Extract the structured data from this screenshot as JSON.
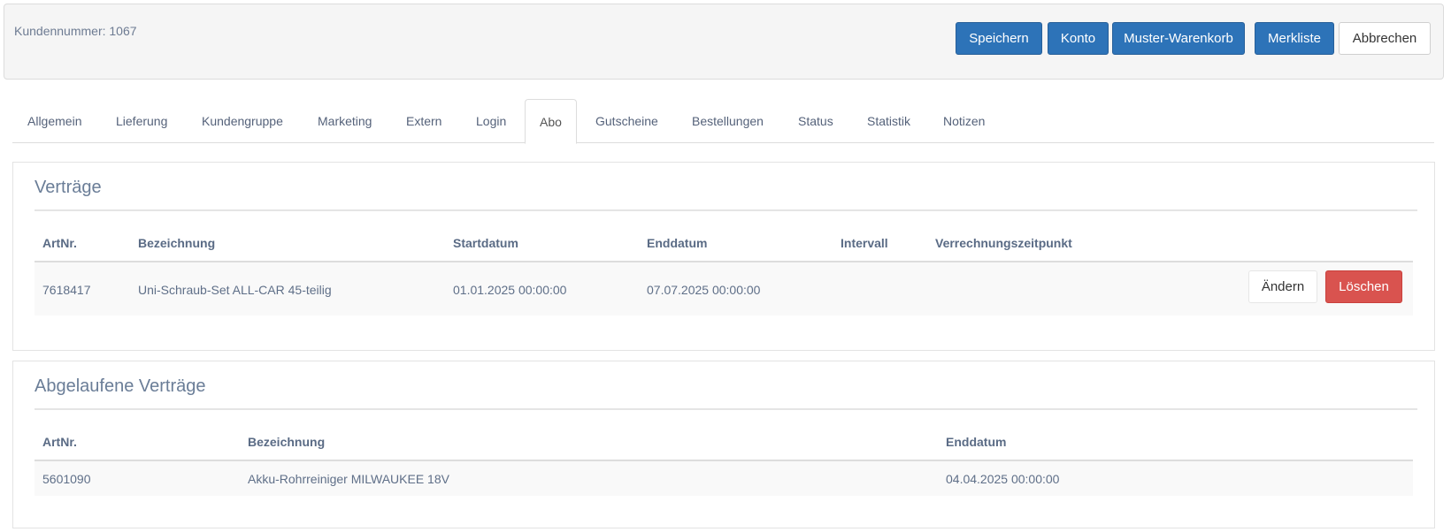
{
  "header": {
    "customer_number": "Kundennummer: 1067",
    "buttons": {
      "save": "Speichern",
      "account": "Konto",
      "sample_cart": "Muster-Warenkorb",
      "wishlist": "Merkliste",
      "cancel": "Abbrechen"
    }
  },
  "tabs": [
    {
      "label": "Allgemein"
    },
    {
      "label": "Lieferung"
    },
    {
      "label": "Kundengruppe"
    },
    {
      "label": "Marketing"
    },
    {
      "label": "Extern"
    },
    {
      "label": "Login"
    },
    {
      "label": "Abo",
      "active": true
    },
    {
      "label": "Gutscheine"
    },
    {
      "label": "Bestellungen"
    },
    {
      "label": "Status"
    },
    {
      "label": "Statistik"
    },
    {
      "label": "Notizen"
    }
  ],
  "contracts": {
    "title": "Verträge",
    "columns": [
      "ArtNr.",
      "Bezeichnung",
      "Startdatum",
      "Enddatum",
      "Intervall",
      "Verrechnungszeitpunkt"
    ],
    "rows": [
      {
        "art_nr": "7618417",
        "name": "Uni-Schraub-Set ALL-CAR 45-teilig",
        "start": "01.01.2025 00:00:00",
        "end": "07.07.2025 00:00:00",
        "interval": "",
        "billing": "",
        "edit_label": "Ändern",
        "delete_label": "Löschen"
      }
    ]
  },
  "expired": {
    "title": "Abgelaufene Verträge",
    "columns": [
      "ArtNr.",
      "Bezeichnung",
      "Enddatum"
    ],
    "rows": [
      {
        "art_nr": "5601090",
        "name": "Akku-Rohrreiniger MILWAUKEE 18V",
        "end": "04.04.2025 00:00:00"
      }
    ]
  },
  "colors": {
    "primary": "#2d73b8",
    "danger": "#d9534f",
    "text": "#5a6b85"
  }
}
